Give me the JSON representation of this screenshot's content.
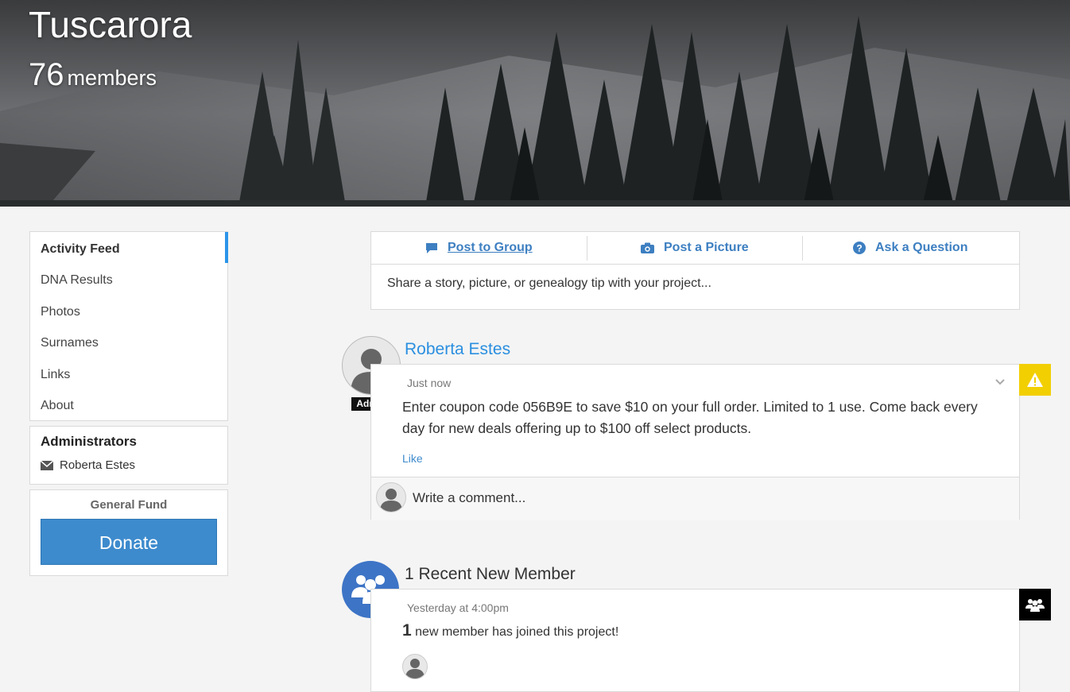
{
  "banner": {
    "title": "Tuscarora",
    "member_count": "76",
    "member_label": "members"
  },
  "nav": {
    "items": [
      {
        "label": "Activity Feed",
        "active": true
      },
      {
        "label": "DNA Results"
      },
      {
        "label": "Photos"
      },
      {
        "label": "Surnames"
      },
      {
        "label": "Links"
      },
      {
        "label": "About"
      }
    ]
  },
  "admins": {
    "title": "Administrators",
    "name": "Roberta Estes"
  },
  "fund": {
    "title": "General Fund",
    "donate_label": "Donate"
  },
  "composer": {
    "tabs": [
      {
        "label": "Post to Group",
        "icon": "speech-bubble-icon"
      },
      {
        "label": "Post a Picture",
        "icon": "camera-icon"
      },
      {
        "label": "Ask a Question",
        "icon": "question-icon"
      }
    ],
    "placeholder": "Share a story, picture, or genealogy tip with your project..."
  },
  "post": {
    "author": "Roberta Estes",
    "badge": "Admin",
    "time": "Just now",
    "text": "Enter coupon code 056B9E to save $10 on your full order. Limited to 1 use. Come back every day for new deals offering up to $100 off select products.",
    "like_label": "Like",
    "comment_placeholder": "Write a comment...",
    "flag_color": "#f2cf00"
  },
  "new_members": {
    "title": "1 Recent New Member",
    "time": "Yesterday at 4:00pm",
    "count": "1",
    "text": "new member has joined this project!",
    "icon_color": "#3d74c6"
  },
  "colors": {
    "accent": "#2b95e9",
    "link": "#3d8bcd",
    "donate": "#3d8bcd"
  }
}
